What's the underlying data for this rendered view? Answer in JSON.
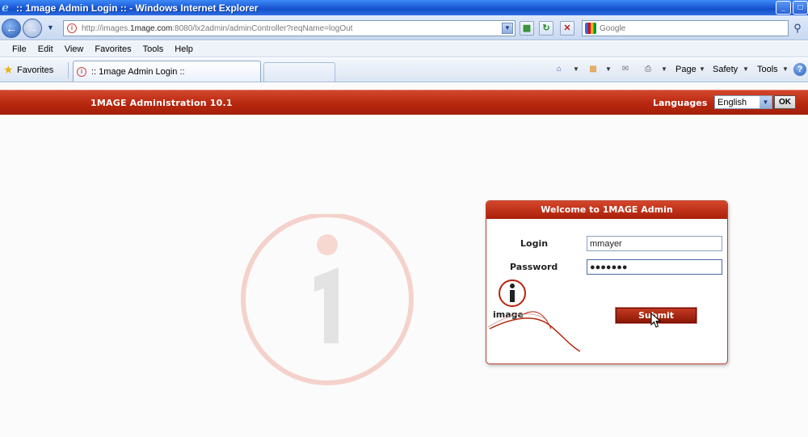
{
  "window": {
    "title": ":: 1mage Admin Login :: - Windows Internet Explorer",
    "minimize": "_",
    "maximize": "□"
  },
  "address": {
    "url_prefix": "http://images.",
    "url_host": "1mage.com",
    "url_suffix": ":8080/lx2admin/adminController?reqName=logOut",
    "search_placeholder": "Google"
  },
  "menu": [
    "File",
    "Edit",
    "View",
    "Favorites",
    "Tools",
    "Help"
  ],
  "favorites": {
    "label": "Favorites",
    "tab_label": ":: 1mage Admin Login ::"
  },
  "commands": {
    "page": "Page",
    "safety": "Safety",
    "tools": "Tools"
  },
  "site": {
    "title": "1MAGE Administration 10.1",
    "languages_label": "Languages",
    "language_value": "English",
    "ok_label": "OK"
  },
  "login": {
    "heading": "Welcome to 1MAGE Admin",
    "login_label": "Login",
    "login_value": "mmayer",
    "password_label": "Password",
    "password_value": "●●●●●●●",
    "submit_label": "Submit",
    "logo_text": "image"
  },
  "colors": {
    "brand_red": "#b7280f",
    "ie_blue": "#1e5fd8"
  }
}
